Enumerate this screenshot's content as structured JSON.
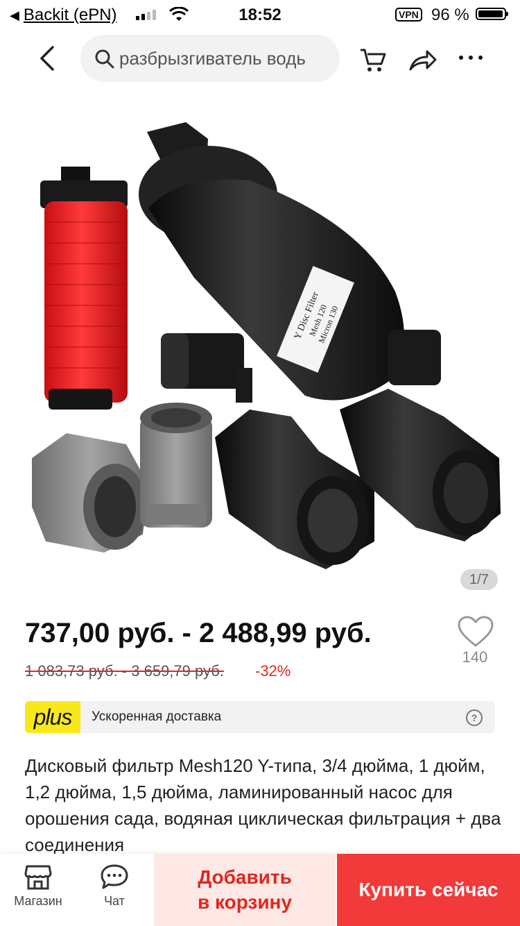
{
  "status_bar": {
    "back_app": "Backit (ePN)",
    "time": "18:52",
    "vpn": "VPN",
    "battery": "96 %"
  },
  "nav": {
    "search_query": "разбрызгиватель водь"
  },
  "product": {
    "image_counter": "1/7",
    "price_range": "737,00 руб. - 2 488,99 руб.",
    "old_price_range": "1 083,73 руб. - 3 659,79 руб.",
    "discount": "-32%",
    "wishlist_count": "140",
    "title": "Дисковый фильтр Mesh120 Y-типа, 3/4 дюйма, 1 дюйм, 1,2 дюйма, 1,5 дюйма, ламинированный насос для орошения сада, водяная циклическая фильтрация + два соединения",
    "label_lines": [
      "Y Disc Filter",
      "Mesh 120",
      "Micron 130"
    ]
  },
  "plus": {
    "logo": "plus",
    "text": "Ускоренная доставка",
    "help": "?"
  },
  "bottom": {
    "store": "Магазин",
    "chat": "Чат",
    "add_to_cart_line1": "Добавить",
    "add_to_cart_line2": "в корзину",
    "buy_now": "Купить сейчас"
  },
  "colors": {
    "accent_red": "#f23a3a",
    "discount_red": "#e0271f",
    "cart_bg": "#fde8e6",
    "plus_yellow": "#f7e81a"
  }
}
